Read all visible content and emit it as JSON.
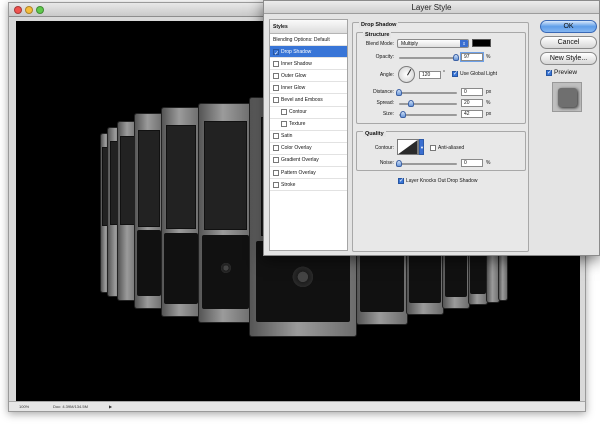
{
  "document": {
    "zoom": "100%",
    "doc_size": "Doc: 4.39M/134.5M"
  },
  "dialog": {
    "title": "Layer Style",
    "styles_header": "Styles",
    "blending_options": "Blending Options: Default",
    "styles": [
      {
        "label": "Drop Shadow",
        "checked": true,
        "selected": true
      },
      {
        "label": "Inner Shadow",
        "checked": false
      },
      {
        "label": "Outer Glow",
        "checked": false
      },
      {
        "label": "Inner Glow",
        "checked": false
      },
      {
        "label": "Bevel and Emboss",
        "checked": false
      },
      {
        "label": "Contour",
        "checked": false,
        "indent": true
      },
      {
        "label": "Texture",
        "checked": false,
        "indent": true
      },
      {
        "label": "Satin",
        "checked": false
      },
      {
        "label": "Color Overlay",
        "checked": false
      },
      {
        "label": "Gradient Overlay",
        "checked": false
      },
      {
        "label": "Pattern Overlay",
        "checked": false
      },
      {
        "label": "Stroke",
        "checked": false
      }
    ],
    "drop_shadow": {
      "title": "Drop Shadow",
      "structure_label": "Structure",
      "blend_mode_label": "Blend Mode:",
      "blend_mode_value": "Multiply",
      "shadow_color": "#000000",
      "opacity_label": "Opacity:",
      "opacity_value": "97",
      "angle_label": "Angle:",
      "angle_value": "120",
      "angle_unit": "°",
      "use_global_light": "Use Global Light",
      "distance_label": "Distance:",
      "distance_value": "0",
      "spread_label": "Spread:",
      "spread_value": "20",
      "size_label": "Size:",
      "size_value": "42",
      "unit_px": "px",
      "unit_pct": "%",
      "quality_label": "Quality",
      "contour_label": "Contour:",
      "anti_aliased": "Anti-aliased",
      "noise_label": "Noise:",
      "noise_value": "0",
      "knockout": "Layer Knocks Out Drop Shadow"
    },
    "buttons": {
      "ok": "OK",
      "cancel": "Cancel",
      "new_style": "New Style...",
      "preview": "Preview"
    }
  }
}
